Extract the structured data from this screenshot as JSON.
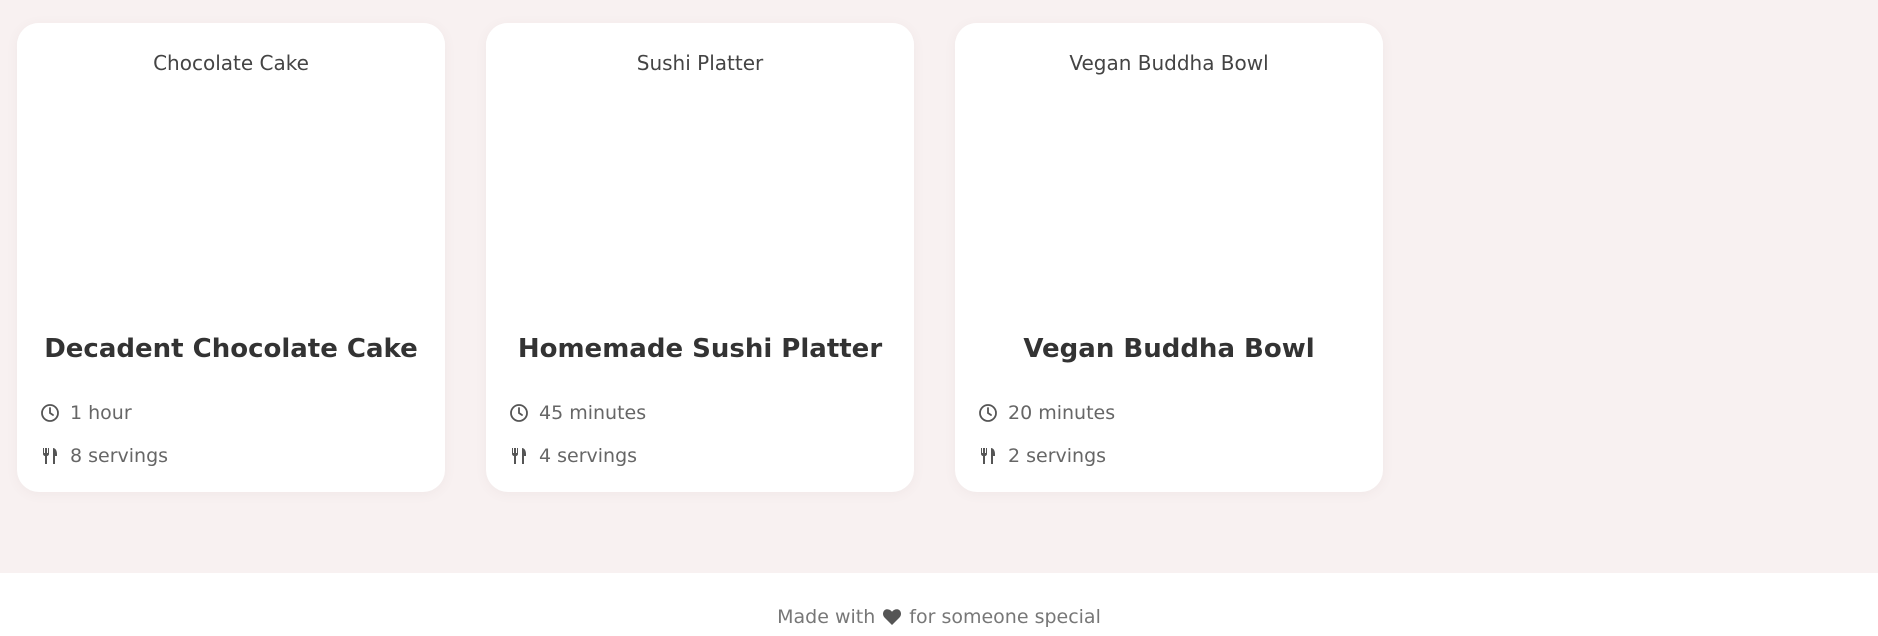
{
  "recipes": [
    {
      "image_alt": "Chocolate Cake",
      "title": "Decadent Chocolate Cake",
      "time": "1 hour",
      "servings": "8 servings",
      "time_icon": "clock-icon",
      "servings_icon": "utensils-icon"
    },
    {
      "image_alt": "Sushi Platter",
      "title": "Homemade Sushi Platter",
      "time": "45 minutes",
      "servings": "4 servings",
      "time_icon": "clock-icon",
      "servings_icon": "utensils-icon"
    },
    {
      "image_alt": "Vegan Buddha Bowl",
      "title": "Vegan Buddha Bowl",
      "time": "20 minutes",
      "servings": "2 servings",
      "time_icon": "clock-icon",
      "servings_icon": "utensils-icon"
    }
  ],
  "footer": {
    "prefix": "Made with",
    "suffix": "for someone special",
    "heart_icon": "heart-icon"
  },
  "colors": {
    "page_background": "#f8f1f1",
    "card_background": "#ffffff",
    "text_dark": "#333333",
    "text_muted": "#666666"
  }
}
